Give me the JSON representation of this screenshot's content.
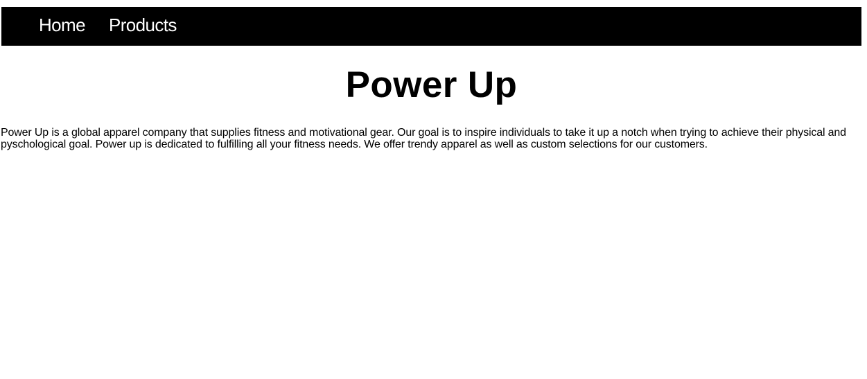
{
  "nav": {
    "items": [
      {
        "label": "Home"
      },
      {
        "label": "Products"
      }
    ],
    "background_color": "#000000",
    "text_color": "#ffffff"
  },
  "main": {
    "title": "Power Up",
    "description": "Power Up is a global apparel company that supplies fitness and motivational gear. Our goal is to inspire individuals to take it up a notch when trying to achieve their physical and pyschological goal. Power up is dedicated to fulfilling all your fitness needs. We offer trendy apparel as well as custom selections for our customers."
  }
}
